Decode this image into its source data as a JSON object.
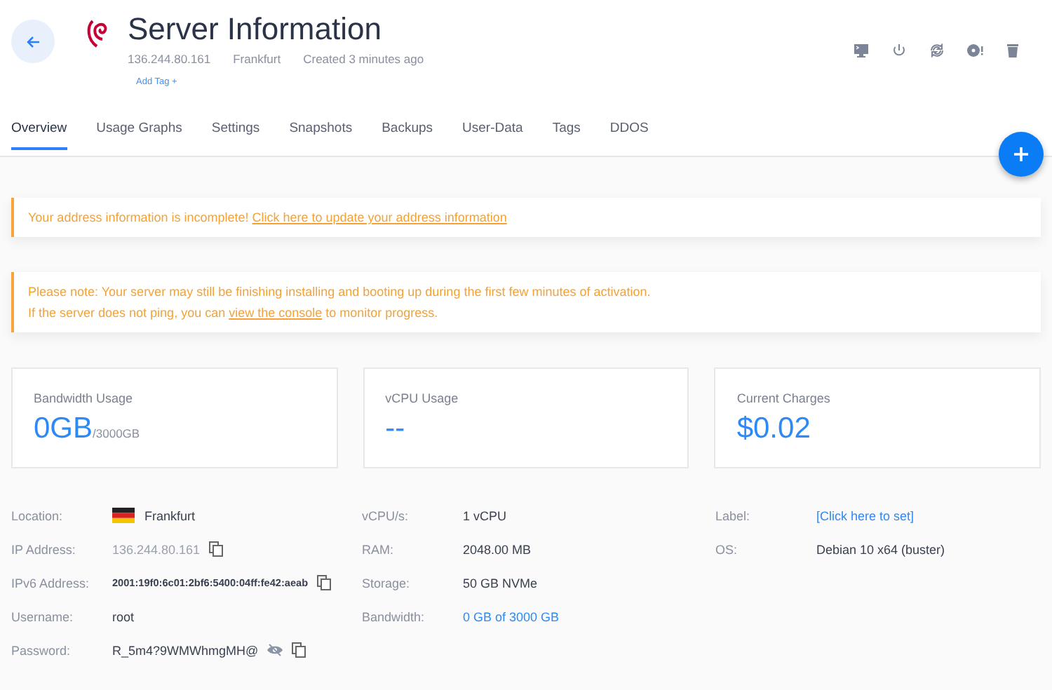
{
  "header": {
    "title": "Server Information",
    "meta": [
      "136.244.80.161",
      "Frankfurt",
      "Created 3 minutes ago"
    ],
    "add_tag": "Add Tag +"
  },
  "tabs": [
    {
      "label": "Overview",
      "selected": true
    },
    {
      "label": "Usage Graphs",
      "selected": false
    },
    {
      "label": "Settings",
      "selected": false
    },
    {
      "label": "Snapshots",
      "selected": false
    },
    {
      "label": "Backups",
      "selected": false
    },
    {
      "label": "User-Data",
      "selected": false
    },
    {
      "label": "Tags",
      "selected": false
    },
    {
      "label": "DDOS",
      "selected": false
    }
  ],
  "alerts": [
    {
      "lines": [
        {
          "before": "Your address information is incomplete!  ",
          "link": "Click here to update your address information"
        }
      ]
    },
    {
      "lines": [
        {
          "before": "Please note: Your server may still be finishing installing and booting up during the first few minutes of activation."
        },
        {
          "before": "If the server does not ping, you can ",
          "link": "view the console",
          "after": " to monitor progress."
        }
      ]
    }
  ],
  "stats": [
    {
      "label": "Bandwidth Usage",
      "value": "0GB",
      "unit": "/3000GB"
    },
    {
      "label": "vCPU Usage",
      "value": "--"
    },
    {
      "label": "Current Charges",
      "value": "$0.02"
    }
  ],
  "details": [
    [
      {
        "label": "Location:",
        "value": "Frankfurt",
        "kind": "flag",
        "copy": false
      },
      {
        "label": "IP Address:",
        "value": "136.244.80.161",
        "kind": "muted",
        "copy": true
      },
      {
        "label": "IPv6 Address:",
        "value": "2001:19f0:6c01:2bf6:5400:04ff:fe42:aeab",
        "kind": "mono",
        "copy": true
      },
      {
        "label": "Username:",
        "value": "root",
        "kind": "plain",
        "copy": false
      },
      {
        "label": "Password:",
        "value": "R_5m4?9WMWhmgMH@",
        "kind": "secret",
        "copy": true
      }
    ],
    [
      {
        "label": "vCPU/s:",
        "value": "1 vCPU",
        "kind": "plain",
        "copy": false
      },
      {
        "label": "RAM:",
        "value": "2048.00 MB",
        "kind": "plain",
        "copy": false
      },
      {
        "label": "Storage:",
        "value": "50 GB NVMe",
        "kind": "plain",
        "copy": false
      },
      {
        "label": "Bandwidth:",
        "value": "0 GB of 3000 GB",
        "kind": "link",
        "copy": false
      }
    ],
    [
      {
        "label": "Label:",
        "value": "[Click here to set]",
        "kind": "link",
        "copy": false
      },
      {
        "label": "OS:",
        "value": "Debian 10 x64 (buster)",
        "kind": "plain",
        "copy": false
      }
    ]
  ]
}
